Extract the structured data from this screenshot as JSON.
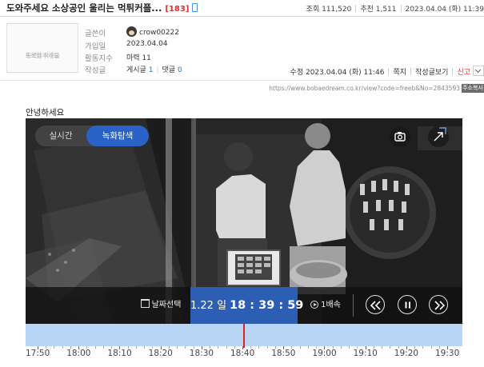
{
  "post": {
    "title": "도와주세요 소상공인 울리는 먹튀커플...",
    "comment_count": "[183]",
    "stats": {
      "views": "조회 111,520",
      "recommends": "추천 1,511",
      "datetime": "2023.04.04 (화) 11:39"
    }
  },
  "profile": {
    "photo_placeholder_line1": "프로필 사진을",
    "photo_placeholder_line2": "등록해주세요",
    "labels": {
      "author": "글쓴이",
      "joined": "가입일",
      "activity": "활동지수",
      "posts": "작성글"
    },
    "author_name": "crow00222",
    "joined_date": "2023.04.04",
    "activity_prefix": "마력",
    "activity_value": "11",
    "posts_label": "게시글",
    "posts_value": "1",
    "comments_label": "댓글",
    "comments_value": "0"
  },
  "actions": {
    "edited": "수정 2023.04.04 (화) 11:46",
    "note": "쪽지",
    "view_posts": "작성글보기",
    "report": "신고"
  },
  "url": {
    "text": "https://www.bobaedream.co.kr/view?code=freeb&No=2843593",
    "copy_label": "주소복사"
  },
  "content": {
    "greeting": "안녕하세요"
  },
  "player": {
    "mode_live": "실시간",
    "mode_recorded": "녹화탐색",
    "date_select": "날짜선택",
    "time_date": "1.22 일",
    "time_clock": "18 : 39 : 59",
    "speed": "1배속",
    "icons": {
      "camera": "camera-icon",
      "expand": "expand-icon",
      "rewind": "rewind-icon",
      "pause": "pause-icon",
      "forward": "fast-forward-icon"
    },
    "accent_color": "#2c5fb3"
  },
  "timeline": {
    "labels": [
      "17:50",
      "18:00",
      "18:10",
      "18:20",
      "18:30",
      "18:40",
      "18:50",
      "19:00",
      "19:10",
      "19:20",
      "19:30"
    ],
    "playhead_time": "18:39:59"
  }
}
